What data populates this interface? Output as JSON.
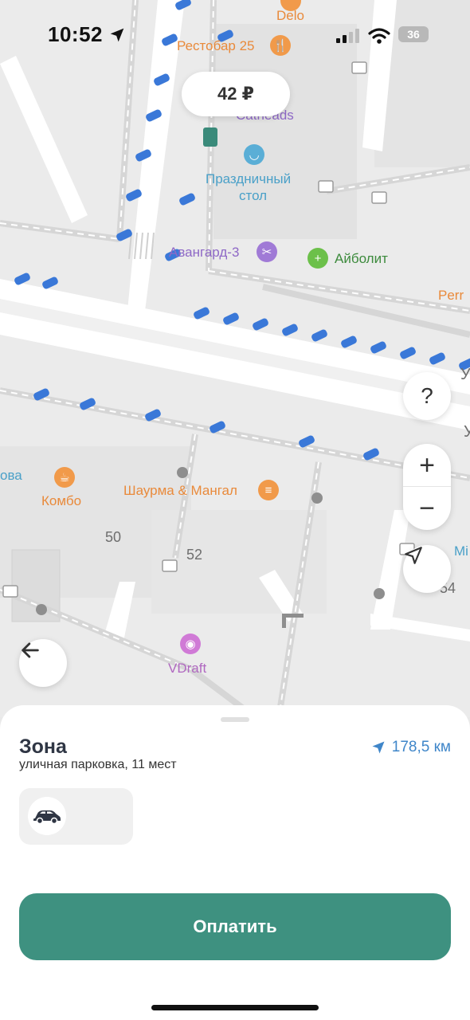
{
  "status_bar": {
    "time": "10:52",
    "battery": "36"
  },
  "map": {
    "price_bubble": "42 ₽",
    "pois": {
      "delo": "Delo",
      "restobar": "Рестобар 25",
      "catheads": "Catheads",
      "prazdnichny": "Праздничный",
      "stol": "стол",
      "avangard": "Авангард-3",
      "aibolit": "Айболит",
      "perr": "Perr",
      "kombo": "Комбо",
      "ova": "ова",
      "shaurma": "Шаурма & Мангал",
      "vdraft": "VDraft",
      "mi": "Mi"
    },
    "house_numbers": {
      "n50": "50",
      "n52": "52",
      "n54": "54"
    },
    "street_letters": {
      "y1": "У",
      "y2": "У"
    }
  },
  "controls": {
    "help_label": "?",
    "zoom_in_label": "+",
    "zoom_out_label": "−"
  },
  "sheet": {
    "title": "Зона",
    "subtitle": "уличная парковка, 11 мест",
    "distance": "178,5 км",
    "pay_label": "Оплатить"
  },
  "colors": {
    "accent": "#3e9180",
    "distance": "#3f86c9",
    "parking_blue": "#3a78d8"
  },
  "icons": [
    "location-arrow-icon",
    "signal-icon",
    "wifi-icon",
    "battery-icon",
    "question-icon",
    "navigate-icon",
    "back-arrow-icon",
    "car-icon"
  ]
}
